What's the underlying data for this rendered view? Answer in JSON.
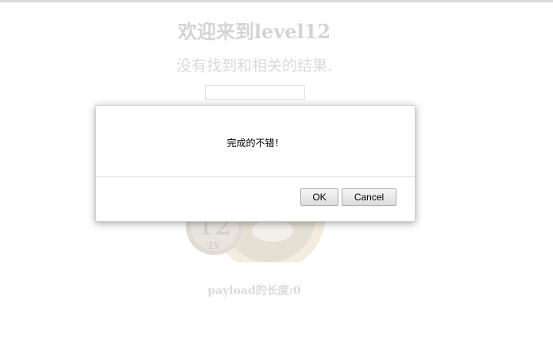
{
  "page": {
    "title": "欢迎来到level12",
    "result_text": "没有找到和相关的结果.",
    "search_value": "",
    "payload_length": "payload的长度:0",
    "level_badge": {
      "number": "12",
      "label": "LV"
    }
  },
  "dialog": {
    "message": "完成的不错！",
    "ok_label": "OK",
    "cancel_label": "Cancel"
  },
  "colors": {
    "page_text": "#bdbdbd",
    "dialog_bg": "#ffffff",
    "button_border": "#adadad"
  }
}
